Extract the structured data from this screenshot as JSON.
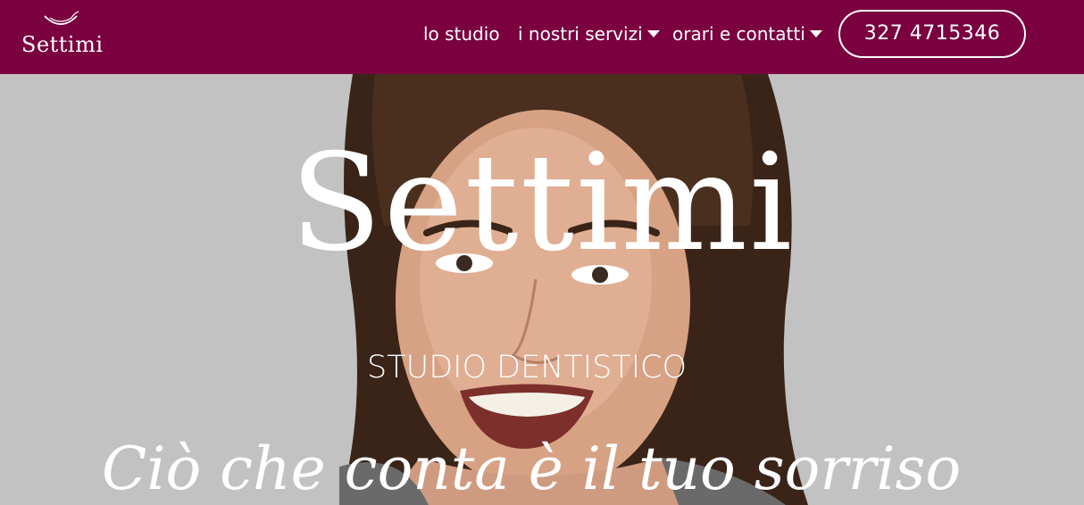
{
  "brand": {
    "name": "Settimi",
    "primary_color": "#7a0040",
    "logo_icon": "smile-icon"
  },
  "nav": {
    "items": [
      {
        "label": "lo studio",
        "has_dropdown": false
      },
      {
        "label": "i nostri servizi",
        "has_dropdown": true
      },
      {
        "label": "orari e contatti",
        "has_dropdown": true
      }
    ],
    "phone": "327 4715346"
  },
  "hero": {
    "title": "Settimi",
    "subtitle": "STUDIO DENTISTICO",
    "tagline": "Ciò che conta è il tuo sorriso",
    "background_color": "#c2c2c2",
    "image": "smiling-woman-portrait"
  }
}
